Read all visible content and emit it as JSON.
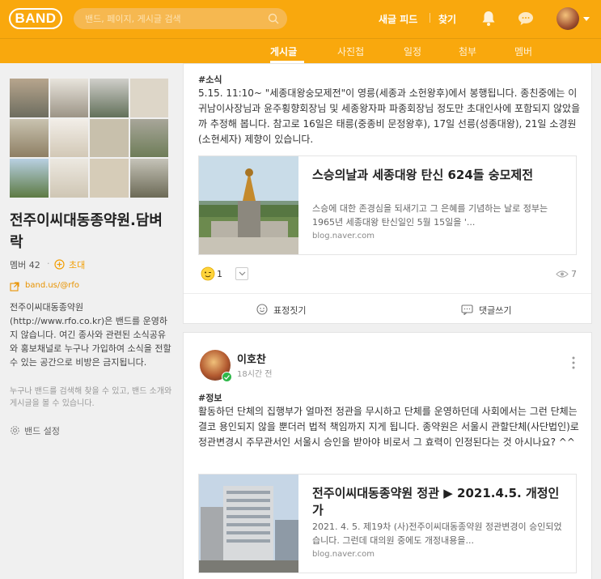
{
  "header": {
    "logo": "BAND",
    "search_placeholder": "밴드, 페이지, 게시글 검색",
    "links": [
      "새글 피드",
      "찾기"
    ]
  },
  "subnav": {
    "tabs": [
      "게시글",
      "사진첩",
      "일정",
      "첨부",
      "멤버"
    ],
    "active": "게시글"
  },
  "sidebar": {
    "band_name": "전주이씨대동종약원.담벼락",
    "member_label": "멤버 42",
    "invite_label": "초대",
    "band_url": "band.us/@rfo",
    "description": "전주이씨대동종약원(http://www.rfo.co.kr)은 밴드를 운영하지 않습니다. 여긴 종사와 관련된 소식공유와 홍보채널로 누구나 가입하여 소식을 전할 수 있는 공간으로 비방은 금지됩니다.",
    "hint": "누구나 밴드를 검색해 찾을 수 있고, 밴드 소개와 게시글을 볼 수 있습니다.",
    "settings_label": "밴드 설정"
  },
  "posts": [
    {
      "tag": "#소식",
      "text": "5.15. 11:10~ \"세종대왕숭모제전\"이 영릉(세종과 소헌왕후)에서 봉행됩니다. 종친중에는 이귀남이사장님과 윤주횡향회장님 및 세종왕자파 파종회장님 정도만 초대인사에 포함되지 않았을까 추정해 봅니다. 참고로 16일은 태릉(중종비 문정왕후), 17일 선릉(성종대왕), 21일 소경원(소현세자) 제향이 있습니다.",
      "link": {
        "title": "스승의날과 세종대왕 탄신 624돌 숭모제전",
        "description": "스승에 대한 존경심을 되새기고 그 은혜를 기념하는 날로 정부는 1965년 세종대왕 탄신일인 5월 15일을 '...",
        "domain": "blog.naver.com"
      },
      "reaction_count": "1",
      "view_count": "7",
      "actions": [
        "표정짓기",
        "댓글쓰기"
      ]
    },
    {
      "author": "이호찬",
      "time": "18시간 전",
      "tag": "#정보",
      "text": "활동하던 단체의 집행부가 얼마전 정관을 무시하고 단체를 운영하던데 사회에서는 그런 단체는 결코 용인되지 않을 뿐더러 법적 책임까지 지게 됩니다. 종약원은 서울시 관할단체(사단법인)로 정관변경시 주무관서인 서울시 승인을 받아야 비로서 그 효력이 인정된다는 것 아시나요? ^^",
      "link": {
        "title": "전주이씨대동종약원 정관 ▶ 2021.4.5. 개정인가",
        "description": "2021. 4. 5. 제19차 (사)전주이씨대동종약원 정관변경이 승인되었습니다. 그런데 대의원 중에도 개정내용을...",
        "domain": "blog.naver.com"
      }
    }
  ]
}
